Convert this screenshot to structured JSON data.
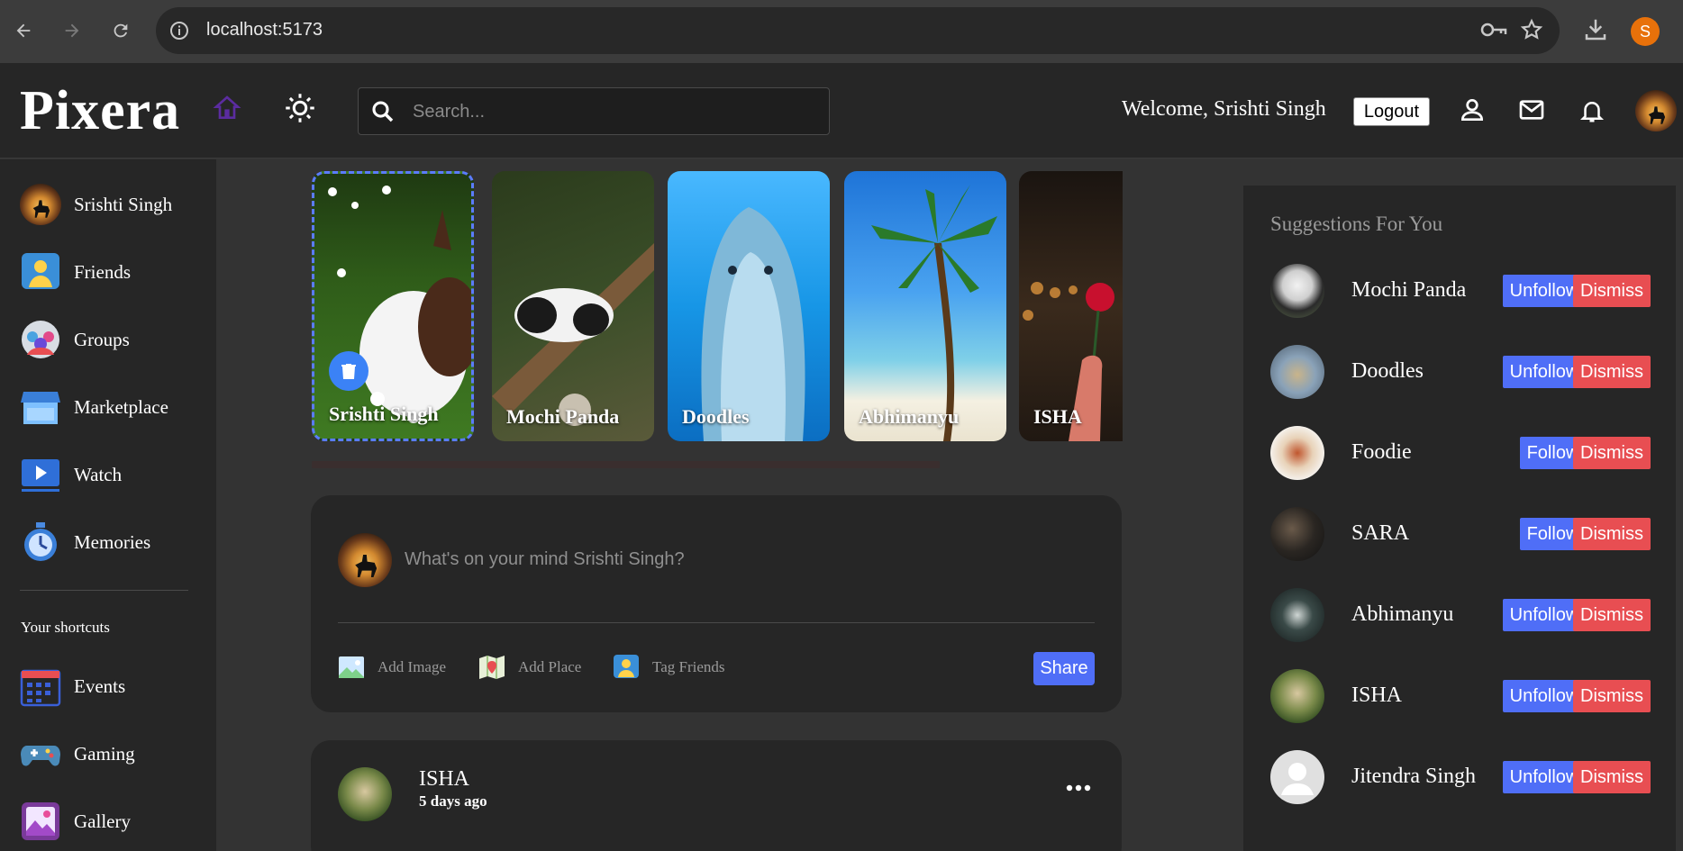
{
  "browser": {
    "url": "localhost:5173",
    "profile_initial": "S"
  },
  "header": {
    "logo": "Pixera",
    "search_placeholder": "Search...",
    "welcome": "Welcome, Srishti Singh",
    "logout_label": "Logout"
  },
  "sidebar": {
    "items": [
      {
        "label": "Srishti Singh",
        "icon": "user-avatar-icon"
      },
      {
        "label": "Friends",
        "icon": "friends-icon"
      },
      {
        "label": "Groups",
        "icon": "groups-icon"
      },
      {
        "label": "Marketplace",
        "icon": "marketplace-icon"
      },
      {
        "label": "Watch",
        "icon": "watch-icon"
      },
      {
        "label": "Memories",
        "icon": "memories-icon"
      }
    ],
    "shortcuts_heading": "Your shortcuts",
    "shortcuts": [
      {
        "label": "Events",
        "icon": "calendar-icon"
      },
      {
        "label": "Gaming",
        "icon": "gamepad-icon"
      },
      {
        "label": "Gallery",
        "icon": "gallery-icon"
      }
    ]
  },
  "stories": [
    {
      "name": "Srishti Singh",
      "mine": true
    },
    {
      "name": "Mochi Panda"
    },
    {
      "name": "Doodles"
    },
    {
      "name": "Abhimanyu"
    },
    {
      "name": "ISHA"
    }
  ],
  "composer": {
    "placeholder": "What's on your mind Srishti Singh?",
    "actions": [
      "Add Image",
      "Add Place",
      "Tag Friends"
    ],
    "share_label": "Share"
  },
  "post": {
    "author": "ISHA",
    "time": "5 days ago"
  },
  "suggestions": {
    "title": "Suggestions For You",
    "items": [
      {
        "name": "Mochi Panda",
        "action": "Unfollow",
        "dismiss": "Dismiss"
      },
      {
        "name": "Doodles",
        "action": "Unfollow",
        "dismiss": "Dismiss"
      },
      {
        "name": "Foodie",
        "action": "Follow",
        "dismiss": "Dismiss"
      },
      {
        "name": "SARA",
        "action": "Follow",
        "dismiss": "Dismiss"
      },
      {
        "name": "Abhimanyu",
        "action": "Unfollow",
        "dismiss": "Dismiss"
      },
      {
        "name": "ISHA",
        "action": "Unfollow",
        "dismiss": "Dismiss"
      },
      {
        "name": "Jitendra Singh",
        "action": "Unfollow",
        "dismiss": "Dismiss"
      }
    ]
  },
  "colors": {
    "accent_blue": "#4f6ef7",
    "dismiss_red": "#e84e52",
    "home_purple": "#5b2ca0"
  }
}
